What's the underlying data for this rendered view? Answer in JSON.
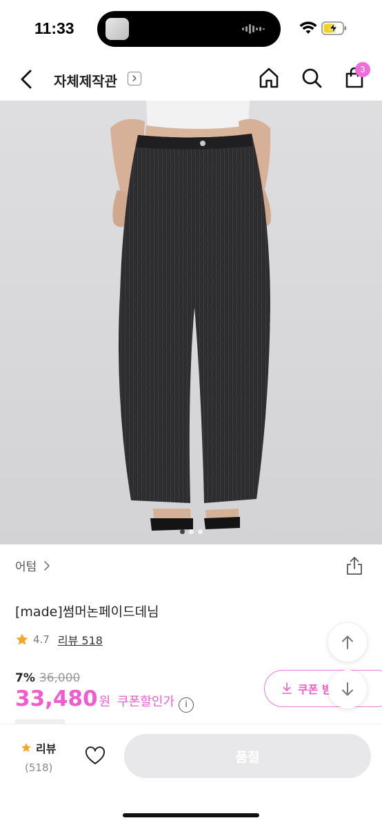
{
  "status_bar": {
    "time": "11:33",
    "icons": [
      "wifi-icon",
      "battery-charging-icon"
    ]
  },
  "header": {
    "title": "자체제작관",
    "cart_count": "3",
    "icons": [
      "back-icon",
      "chevron-right-icon",
      "home-icon",
      "search-icon",
      "shopping-bag-icon"
    ]
  },
  "product_image": {
    "slide_count": 3,
    "active_slide": 1
  },
  "product": {
    "brand": "어텀",
    "name": "[made]썸머논페이드데님",
    "rating": "4.7",
    "review_label": "리뷰 518",
    "discount_rate": "7%",
    "original_price": "36,000",
    "sale_price": "33,480",
    "currency": "원",
    "coupon_price_label": "쿠폰할인가",
    "info_icon_glyph": "i"
  },
  "coupon": {
    "label": "쿠폰 받"
  },
  "bottom_bar": {
    "review_label": "리뷰",
    "review_count": "(518)",
    "soldout_label": "품절"
  },
  "colors": {
    "accent": "#f05bd0",
    "badge": "#f06bdc",
    "star": "#f5a623",
    "soldout_bg": "#e8e8ea"
  }
}
